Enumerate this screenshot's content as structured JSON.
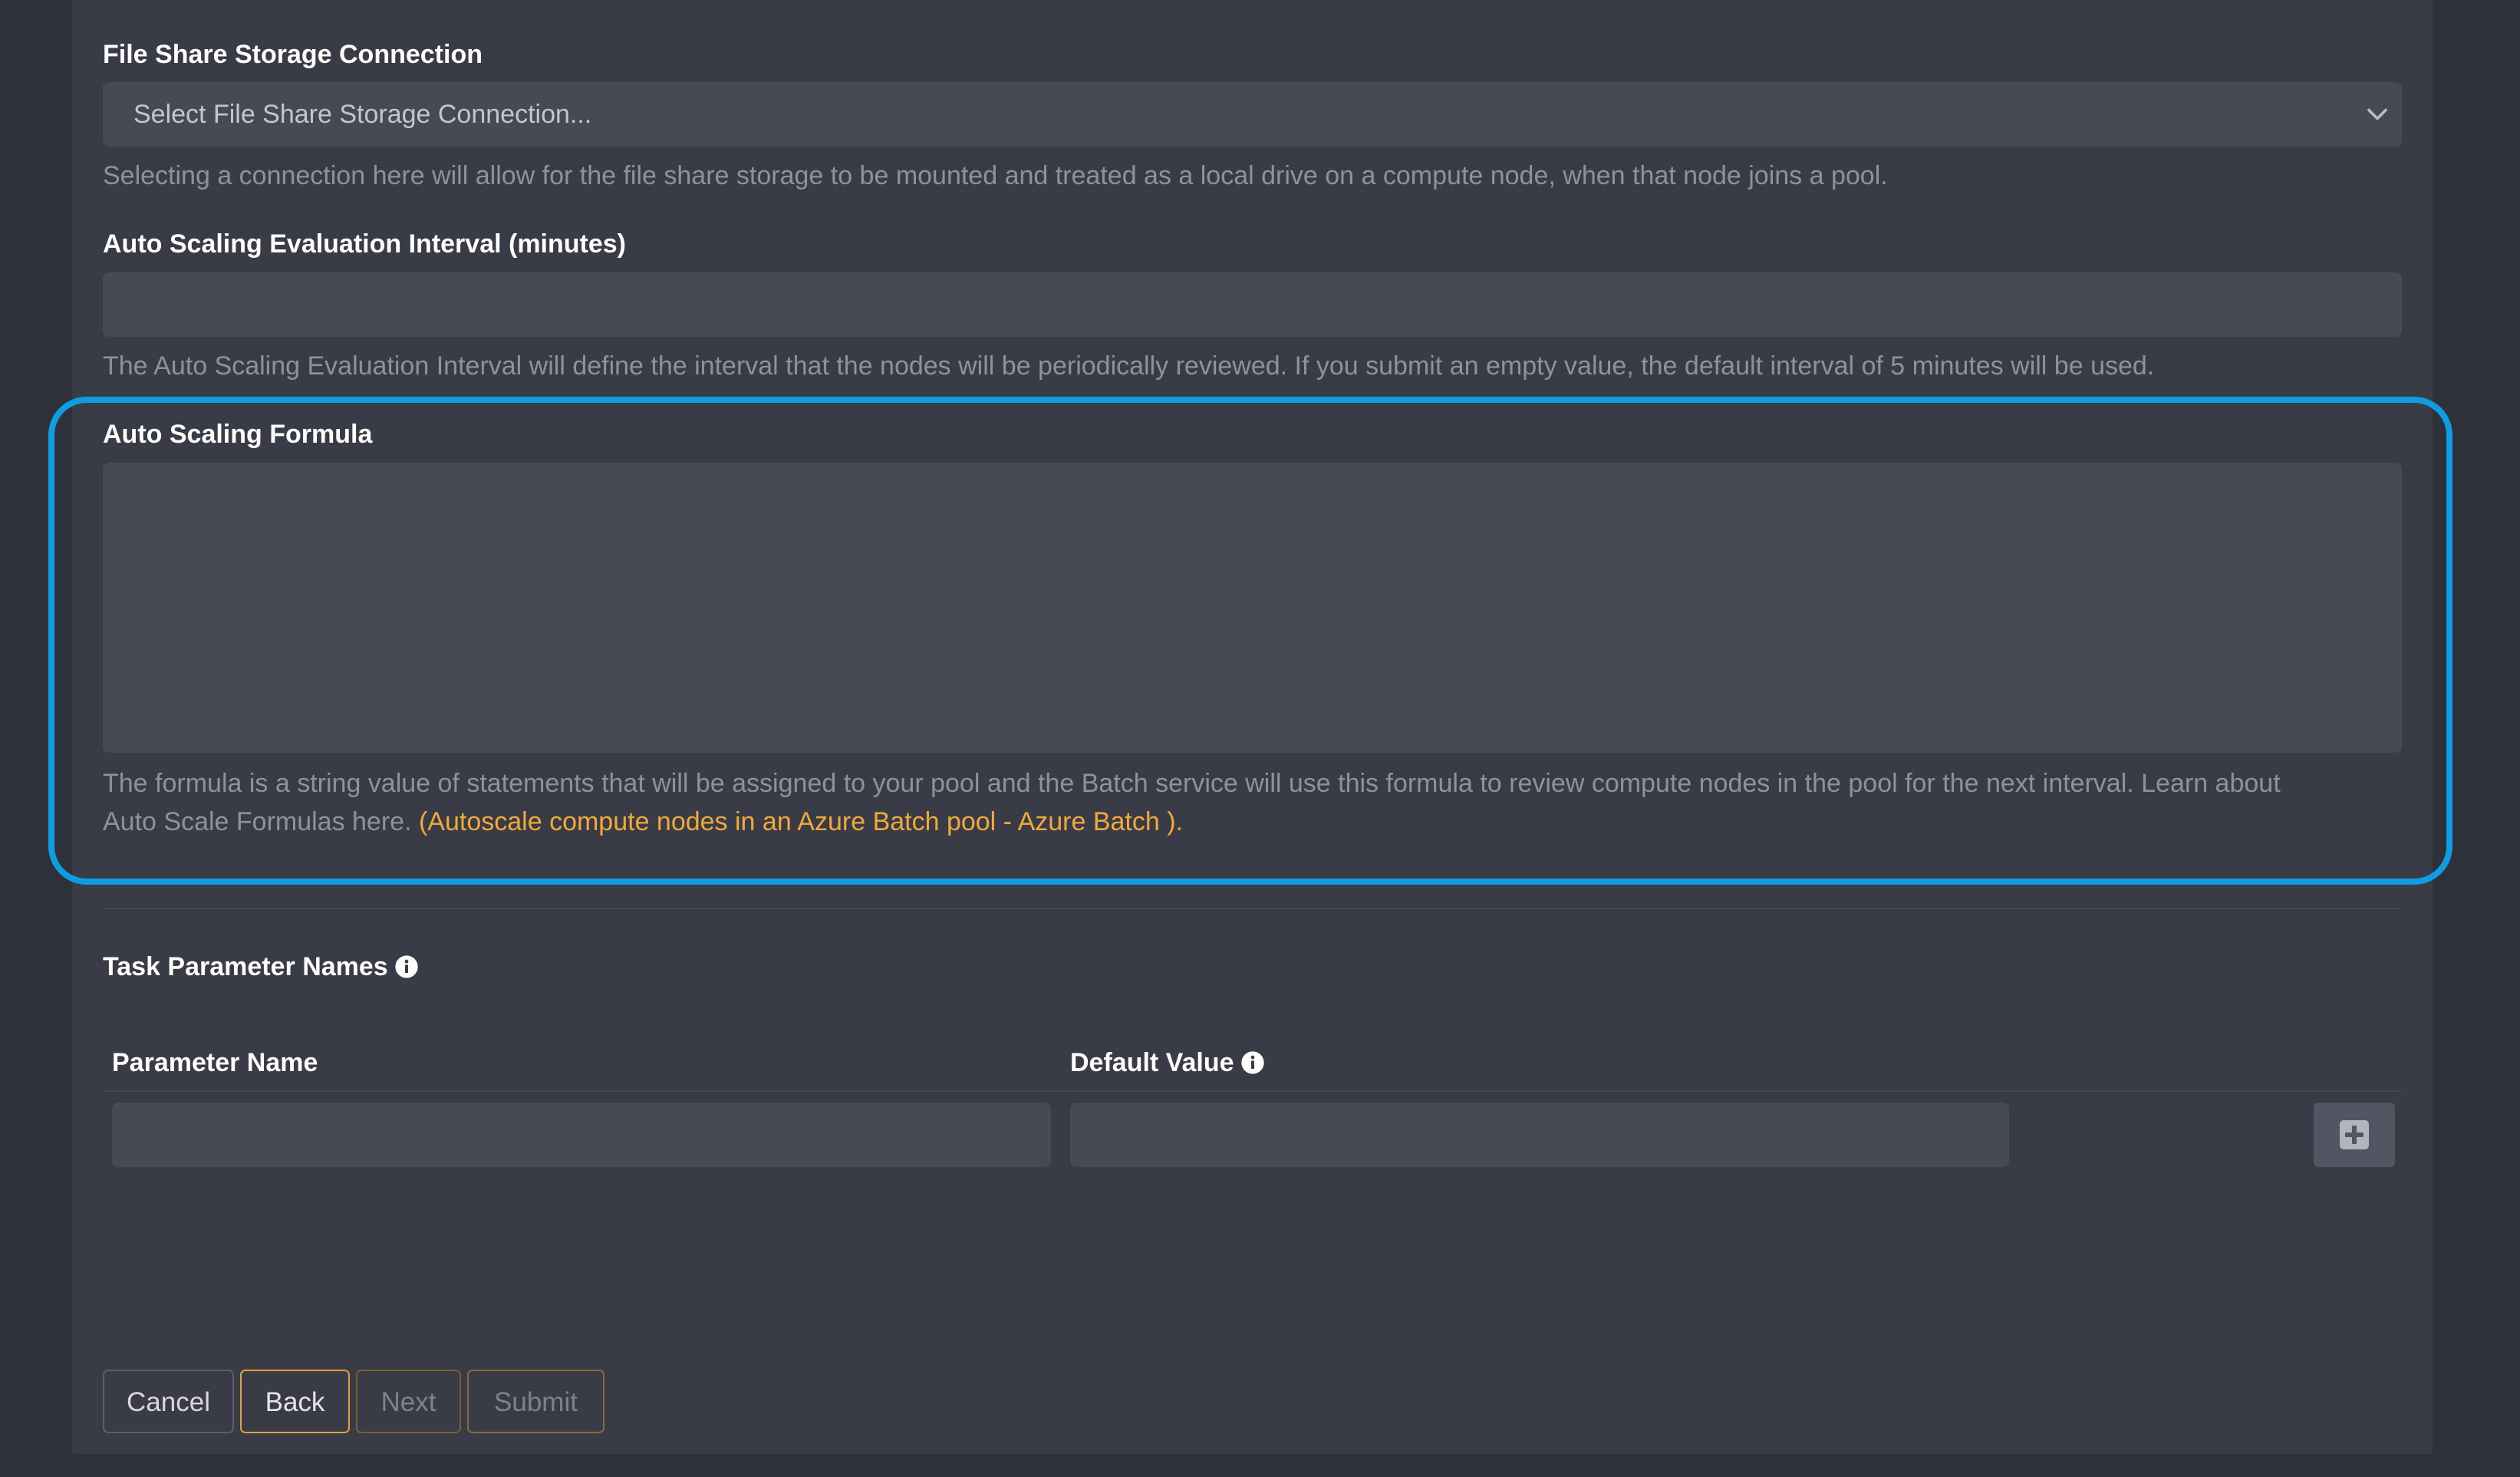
{
  "file_share": {
    "label": "File Share Storage Connection",
    "placeholder": "Select File Share Storage Connection...",
    "help": "Selecting a connection here will allow for the file share storage to be mounted and treated as a local drive on a compute node, when that node joins a pool."
  },
  "auto_scaling_interval": {
    "label": "Auto Scaling Evaluation Interval (minutes)",
    "value": "",
    "help": "The Auto Scaling Evaluation Interval will define the interval that the nodes will be periodically reviewed. If you submit an empty value, the default interval of 5 minutes will be used."
  },
  "auto_scaling_formula": {
    "label": "Auto Scaling Formula",
    "value": "",
    "help_line1": "The formula is a string value of statements that will be assigned to your pool and the Batch service will use this formula to review compute nodes in the pool for the next interval. Learn about",
    "help_line2": "Auto Scale Formulas here.",
    "link_text": "(Autoscale compute nodes in an Azure Batch pool - Azure Batch )."
  },
  "task_parameters": {
    "title": "Task Parameter Names",
    "columns": {
      "name": "Parameter Name",
      "default_value": "Default Value"
    },
    "rows": [
      {
        "name": "",
        "default_value": ""
      }
    ]
  },
  "footer": {
    "cancel": "Cancel",
    "back": "Back",
    "next": "Next",
    "submit": "Submit"
  },
  "colors": {
    "background": "#2e3139",
    "panel": "#393c46",
    "input": "#474a55",
    "highlight": "#0d9de1",
    "link": "#f2a93b"
  }
}
